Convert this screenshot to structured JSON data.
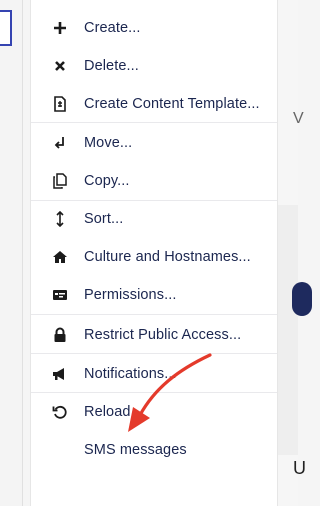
{
  "menu": {
    "items": [
      {
        "label": "Create...",
        "icon": "plus-icon"
      },
      {
        "label": "Delete...",
        "icon": "close-icon"
      },
      {
        "label": "Create Content Template...",
        "icon": "document-icon"
      },
      {
        "label": "Move...",
        "icon": "move-arrow-icon"
      },
      {
        "label": "Copy...",
        "icon": "copy-icon"
      },
      {
        "label": "Sort...",
        "icon": "sort-icon"
      },
      {
        "label": "Culture and Hostnames...",
        "icon": "home-icon"
      },
      {
        "label": "Permissions...",
        "icon": "permissions-icon"
      },
      {
        "label": "Restrict Public Access...",
        "icon": "lock-icon"
      },
      {
        "label": "Notifications...",
        "icon": "megaphone-icon"
      },
      {
        "label": "Reload",
        "icon": "reload-icon"
      },
      {
        "label": "SMS messages",
        "icon": ""
      }
    ]
  },
  "colors": {
    "text": "#1b264f",
    "arrow": "#e43a2b",
    "focus_border": "#3544b1"
  }
}
